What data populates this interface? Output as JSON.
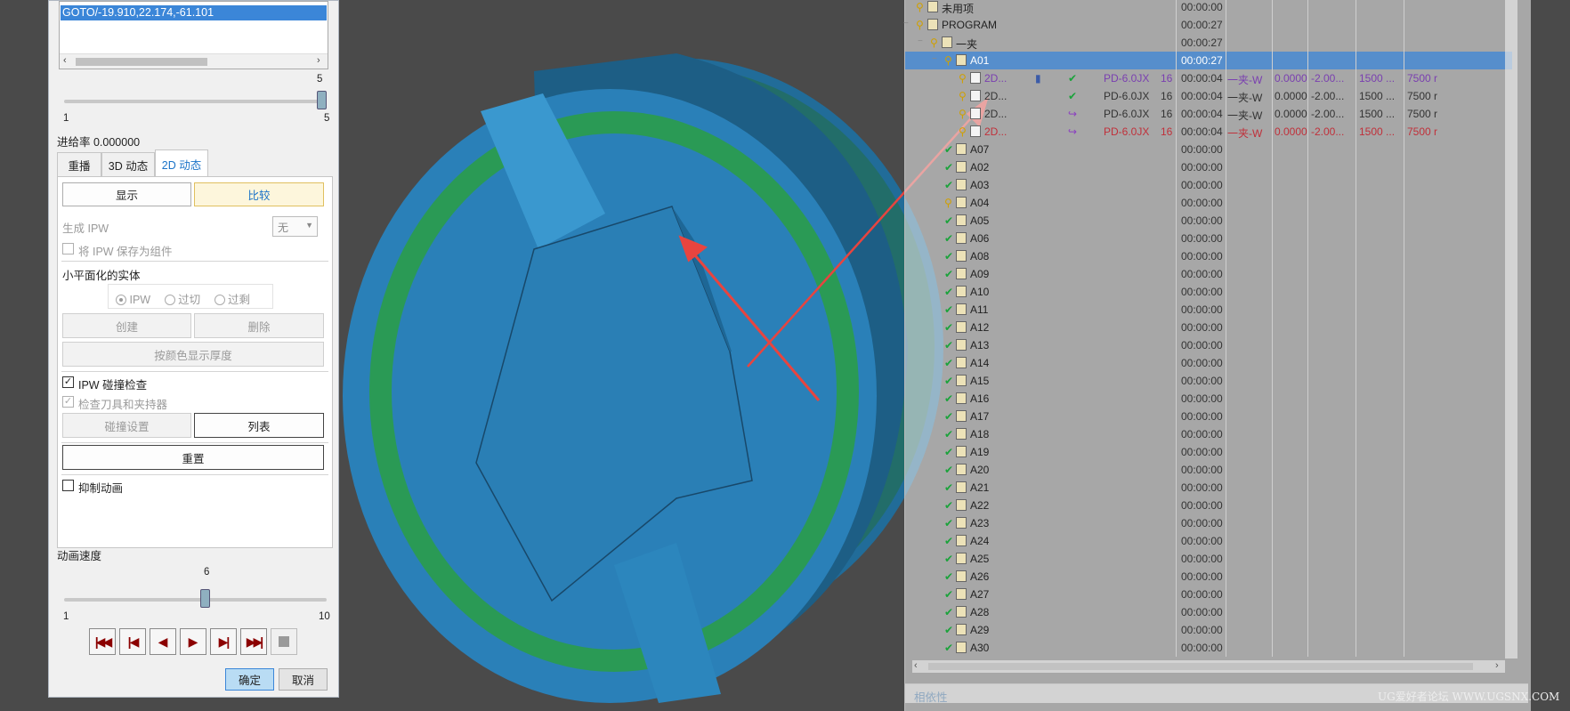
{
  "dialog": {
    "list_selected_item": "GOTO/-19.910,22.174,-61.101",
    "top_slider": {
      "value_label": "5",
      "min_label": "1",
      "max_label": "5",
      "value": 5,
      "min": 1,
      "max": 5
    },
    "feedrate_label": "进给率 0.000000",
    "tabs": [
      {
        "label": "重播"
      },
      {
        "label": "3D 动态"
      },
      {
        "label": "2D 动态"
      }
    ],
    "buttons": {
      "display": "显示",
      "compare": "比较",
      "create": "创建",
      "delete": "删除",
      "show_thickness": "按颜色显示厚度",
      "collision_settings": "碰撞设置",
      "list": "列表",
      "reset": "重置",
      "ok": "确定",
      "cancel": "取消"
    },
    "generate_ipw_label": "生成 IPW",
    "generate_ipw_value": "无",
    "save_ipw_label": "将 IPW 保存为组件",
    "faceted_solid_label": "小平面化的实体",
    "radio_ipw": "IPW",
    "radio_overcut": "过切",
    "radio_excess": "过剩",
    "ipw_collision_label": "IPW 碰撞检查",
    "check_tool_holder_label": "检查刀具和夹持器",
    "suppress_animation_label": "抑制动画",
    "anim_speed_label": "动画速度",
    "speed_slider": {
      "value_label": "6",
      "min_label": "1",
      "max_label": "10",
      "value": 6,
      "min": 1,
      "max": 10
    }
  },
  "tree": {
    "rows": [
      {
        "name": "未用项",
        "time": "00:00:00",
        "level": 1,
        "icon": "folder"
      },
      {
        "name": "PROGRAM",
        "time": "00:00:27",
        "level": 1,
        "icon": "folder"
      },
      {
        "name": "一夹",
        "time": "00:00:27",
        "level": 2,
        "icon": "folder"
      },
      {
        "name": "A01",
        "time": "00:00:27",
        "level": 3,
        "icon": "folder",
        "selected": true
      },
      {
        "name": "2D...",
        "time": "00:00:04",
        "level": 4,
        "icon": "op",
        "tool": "PD-6.0JX",
        "num": "16",
        "geom": "一夹-W",
        "stock": "0.0000",
        "depth": "-2.00...",
        "speed": "1500 ...",
        "feed": "7500 r",
        "color": "purple",
        "status": "check"
      },
      {
        "name": "2D...",
        "time": "00:00:04",
        "level": 4,
        "icon": "op",
        "tool": "PD-6.0JX",
        "num": "16",
        "geom": "一夹-W",
        "stock": "0.0000",
        "depth": "-2.00...",
        "speed": "1500 ...",
        "feed": "7500 r",
        "color": "dark",
        "status": "check"
      },
      {
        "name": "2D...",
        "time": "00:00:04",
        "level": 4,
        "icon": "op",
        "tool": "PD-6.0JX",
        "num": "16",
        "geom": "一夹-W",
        "stock": "0.0000",
        "depth": "-2.00...",
        "speed": "1500 ...",
        "feed": "7500 r",
        "color": "dark",
        "status": "regen"
      },
      {
        "name": "2D...",
        "time": "00:00:04",
        "level": 4,
        "icon": "op",
        "tool": "PD-6.0JX",
        "num": "16",
        "geom": "一夹-W",
        "stock": "0.0000",
        "depth": "-2.00...",
        "speed": "1500 ...",
        "feed": "7500 r",
        "color": "red",
        "status": "regen"
      },
      {
        "name": "A07",
        "time": "00:00:00",
        "level": 3,
        "icon": "folder"
      },
      {
        "name": "A02",
        "time": "00:00:00",
        "level": 3,
        "icon": "folder"
      },
      {
        "name": "A03",
        "time": "00:00:00",
        "level": 3,
        "icon": "folder"
      },
      {
        "name": "A04",
        "time": "00:00:00",
        "level": 3,
        "icon": "folder",
        "key": true
      },
      {
        "name": "A05",
        "time": "00:00:00",
        "level": 3,
        "icon": "folder"
      },
      {
        "name": "A06",
        "time": "00:00:00",
        "level": 3,
        "icon": "folder"
      },
      {
        "name": "A08",
        "time": "00:00:00",
        "level": 3,
        "icon": "folder"
      },
      {
        "name": "A09",
        "time": "00:00:00",
        "level": 3,
        "icon": "folder"
      },
      {
        "name": "A10",
        "time": "00:00:00",
        "level": 3,
        "icon": "folder"
      },
      {
        "name": "A11",
        "time": "00:00:00",
        "level": 3,
        "icon": "folder"
      },
      {
        "name": "A12",
        "time": "00:00:00",
        "level": 3,
        "icon": "folder"
      },
      {
        "name": "A13",
        "time": "00:00:00",
        "level": 3,
        "icon": "folder"
      },
      {
        "name": "A14",
        "time": "00:00:00",
        "level": 3,
        "icon": "folder"
      },
      {
        "name": "A15",
        "time": "00:00:00",
        "level": 3,
        "icon": "folder"
      },
      {
        "name": "A16",
        "time": "00:00:00",
        "level": 3,
        "icon": "folder"
      },
      {
        "name": "A17",
        "time": "00:00:00",
        "level": 3,
        "icon": "folder"
      },
      {
        "name": "A18",
        "time": "00:00:00",
        "level": 3,
        "icon": "folder"
      },
      {
        "name": "A19",
        "time": "00:00:00",
        "level": 3,
        "icon": "folder"
      },
      {
        "name": "A20",
        "time": "00:00:00",
        "level": 3,
        "icon": "folder"
      },
      {
        "name": "A21",
        "time": "00:00:00",
        "level": 3,
        "icon": "folder"
      },
      {
        "name": "A22",
        "time": "00:00:00",
        "level": 3,
        "icon": "folder"
      },
      {
        "name": "A23",
        "time": "00:00:00",
        "level": 3,
        "icon": "folder"
      },
      {
        "name": "A24",
        "time": "00:00:00",
        "level": 3,
        "icon": "folder"
      },
      {
        "name": "A25",
        "time": "00:00:00",
        "level": 3,
        "icon": "folder"
      },
      {
        "name": "A26",
        "time": "00:00:00",
        "level": 3,
        "icon": "folder"
      },
      {
        "name": "A27",
        "time": "00:00:00",
        "level": 3,
        "icon": "folder"
      },
      {
        "name": "A28",
        "time": "00:00:00",
        "level": 3,
        "icon": "folder"
      },
      {
        "name": "A29",
        "time": "00:00:00",
        "level": 3,
        "icon": "folder"
      },
      {
        "name": "A30",
        "time": "00:00:00",
        "level": 3,
        "icon": "folder"
      }
    ],
    "dependency_label": "相依性"
  },
  "watermark": "UG爱好者论坛 WWW.UGSNX.COM",
  "colors": {
    "accent": "#1a73c8",
    "selection": "#3b86d8",
    "part_blue": "#2a7fb5",
    "part_green": "#2a9a55",
    "arrow": "#e8443f"
  }
}
